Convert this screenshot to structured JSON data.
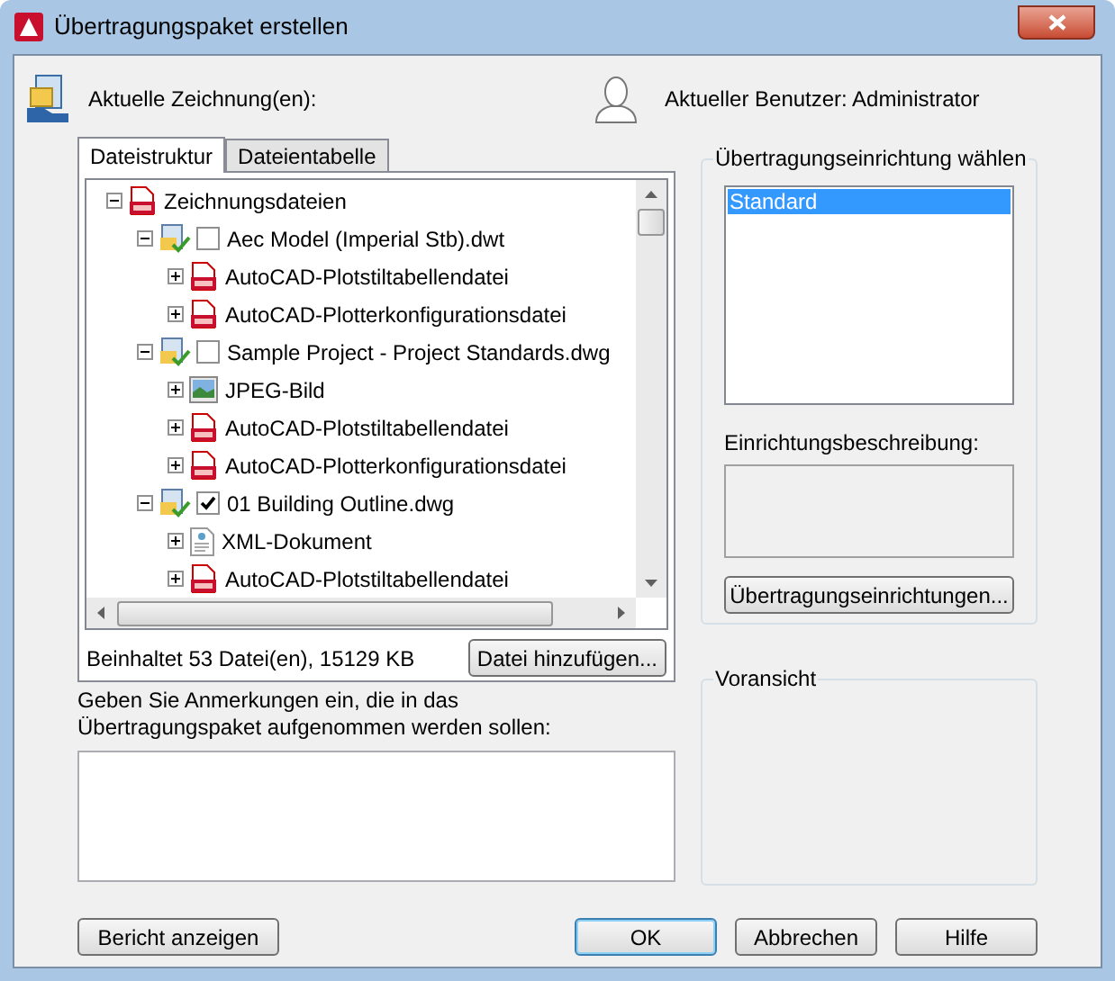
{
  "window": {
    "title": "Übertragungspaket erstellen"
  },
  "current_drawings_label": "Aktuelle Zeichnung(en):",
  "current_user": "Aktueller Benutzer: Administrator",
  "tabs": [
    {
      "label": "Dateistruktur",
      "selected": true
    },
    {
      "label": "Dateientabelle",
      "selected": false
    }
  ],
  "tree": {
    "label": "Zeichnungsdateien",
    "kind": "dwt",
    "expanded": true,
    "children": [
      {
        "label": "Aec Model (Imperial Stb).dwt",
        "kind": "drawing",
        "expanded": true,
        "checked": false,
        "children": [
          {
            "label": "AutoCAD-Plotstiltabellendatei",
            "kind": "stb",
            "expanded": false
          },
          {
            "label": "AutoCAD-Plotterkonfigurationsdatei",
            "kind": "pc3",
            "expanded": false
          }
        ]
      },
      {
        "label": "Sample Project - Project Standards.dwg",
        "kind": "drawing",
        "expanded": true,
        "checked": false,
        "children": [
          {
            "label": "JPEG-Bild",
            "kind": "image",
            "expanded": false
          },
          {
            "label": "AutoCAD-Plotstiltabellendatei",
            "kind": "stb",
            "expanded": false
          },
          {
            "label": "AutoCAD-Plotterkonfigurationsdatei",
            "kind": "pc3",
            "expanded": false
          }
        ]
      },
      {
        "label": "01 Building Outline.dwg",
        "kind": "drawing",
        "expanded": true,
        "checked": true,
        "children": [
          {
            "label": "XML-Dokument",
            "kind": "xml",
            "expanded": false
          },
          {
            "label": "AutoCAD-Plotstiltabellendatei",
            "kind": "stb",
            "expanded": false
          }
        ]
      }
    ]
  },
  "summary": "Beinhaltet 53 Datei(en), 15129 KB",
  "add_file_button": "Datei hinzufügen...",
  "notes_label": "Geben Sie Anmerkungen ein, die in das Übertragungspaket aufgenommen werden sollen:",
  "setup_group": {
    "title": "Übertragungseinrichtung wählen",
    "items": [
      {
        "label": "Standard",
        "selected": true
      }
    ],
    "description_label": "Einrichtungsbeschreibung:",
    "button": "Übertragungseinrichtungen..."
  },
  "preview_group": {
    "title": "Voransicht"
  },
  "buttons": [
    {
      "label": "Bericht anzeigen",
      "default": false
    },
    {
      "label": "OK",
      "default": true
    },
    {
      "label": "Abbrechen",
      "default": false
    },
    {
      "label": "Hilfe",
      "default": false
    }
  ]
}
